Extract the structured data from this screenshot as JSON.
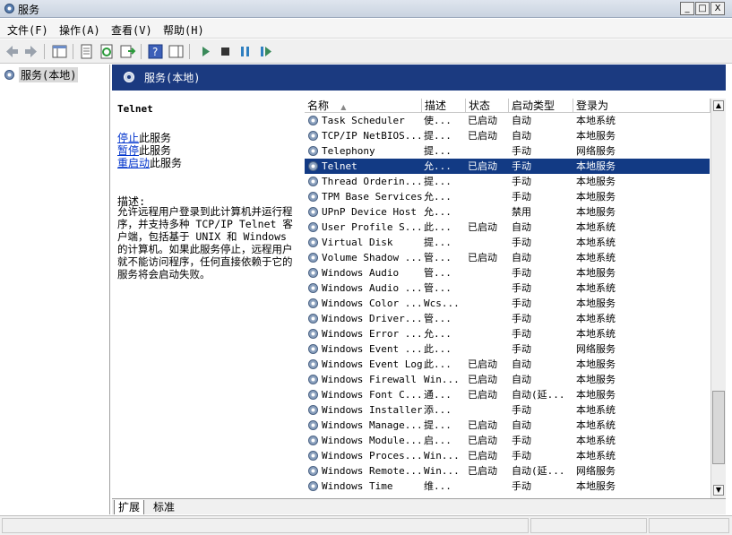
{
  "window": {
    "title": "服务",
    "btn_min": "_",
    "btn_max": "□",
    "btn_close": "X"
  },
  "menubar": [
    {
      "label": "文件(F)"
    },
    {
      "label": "操作(A)"
    },
    {
      "label": "查看(V)"
    },
    {
      "label": "帮助(H)"
    }
  ],
  "toolbar": {
    "icons": [
      "back-arrow-icon",
      "forward-arrow-icon",
      "show-tree-icon",
      "properties-icon",
      "refresh-icon",
      "export-list-icon",
      "help-icon",
      "action-pane-icon",
      "start-service-icon",
      "stop-service-icon",
      "pause-service-icon",
      "resume-service-icon"
    ]
  },
  "tree": {
    "root_label": "服务(本地)"
  },
  "header": {
    "title": "服务(本地)"
  },
  "description_pane": {
    "service_name": "Telnet",
    "stop_link": "停止",
    "stop_suffix": "此服务",
    "pause_link": "暂停",
    "pause_suffix": "此服务",
    "restart_link": "重启动",
    "restart_suffix": "此服务",
    "desc_label": "描述:",
    "desc_text": "允许远程用户登录到此计算机并运行程序，并支持多种 TCP/IP Telnet 客户端，包括基于 UNIX 和 Windows 的计算机。如果此服务停止，远程用户就不能访问程序，任何直接依赖于它的服务将会启动失败。"
  },
  "columns": {
    "name": "名称",
    "desc": "描述",
    "status": "状态",
    "startup": "启动类型",
    "logon": "登录为"
  },
  "rows": [
    {
      "name": "Task Scheduler",
      "desc": "使...",
      "status": "已启动",
      "startup": "自动",
      "logon": "本地系统"
    },
    {
      "name": "TCP/IP NetBIOS...",
      "desc": "提...",
      "status": "已启动",
      "startup": "自动",
      "logon": "本地服务"
    },
    {
      "name": "Telephony",
      "desc": "提...",
      "status": "",
      "startup": "手动",
      "logon": "网络服务"
    },
    {
      "name": "Telnet",
      "desc": "允...",
      "status": "已启动",
      "startup": "手动",
      "logon": "本地服务",
      "selected": true
    },
    {
      "name": "Thread Orderin...",
      "desc": "提...",
      "status": "",
      "startup": "手动",
      "logon": "本地服务"
    },
    {
      "name": "TPM Base Services",
      "desc": "允...",
      "status": "",
      "startup": "手动",
      "logon": "本地服务"
    },
    {
      "name": "UPnP Device Host",
      "desc": "允...",
      "status": "",
      "startup": "禁用",
      "logon": "本地服务"
    },
    {
      "name": "User Profile S...",
      "desc": "此...",
      "status": "已启动",
      "startup": "自动",
      "logon": "本地系统"
    },
    {
      "name": "Virtual Disk",
      "desc": "提...",
      "status": "",
      "startup": "手动",
      "logon": "本地系统"
    },
    {
      "name": "Volume Shadow ...",
      "desc": "管...",
      "status": "已启动",
      "startup": "自动",
      "logon": "本地系统"
    },
    {
      "name": "Windows Audio",
      "desc": "管...",
      "status": "",
      "startup": "手动",
      "logon": "本地服务"
    },
    {
      "name": "Windows Audio ...",
      "desc": "管...",
      "status": "",
      "startup": "手动",
      "logon": "本地系统"
    },
    {
      "name": "Windows Color ...",
      "desc": "Wcs...",
      "status": "",
      "startup": "手动",
      "logon": "本地服务"
    },
    {
      "name": "Windows Driver...",
      "desc": "管...",
      "status": "",
      "startup": "手动",
      "logon": "本地系统"
    },
    {
      "name": "Windows Error ...",
      "desc": "允...",
      "status": "",
      "startup": "手动",
      "logon": "本地系统"
    },
    {
      "name": "Windows Event ...",
      "desc": "此...",
      "status": "",
      "startup": "手动",
      "logon": "网络服务"
    },
    {
      "name": "Windows Event Log",
      "desc": "此...",
      "status": "已启动",
      "startup": "自动",
      "logon": "本地服务"
    },
    {
      "name": "Windows Firewall",
      "desc": "Win...",
      "status": "已启动",
      "startup": "自动",
      "logon": "本地服务"
    },
    {
      "name": "Windows Font C...",
      "desc": "通...",
      "status": "已启动",
      "startup": "自动(延...",
      "logon": "本地服务"
    },
    {
      "name": "Windows Installer",
      "desc": "添...",
      "status": "",
      "startup": "手动",
      "logon": "本地系统"
    },
    {
      "name": "Windows Manage...",
      "desc": "提...",
      "status": "已启动",
      "startup": "自动",
      "logon": "本地系统"
    },
    {
      "name": "Windows Module...",
      "desc": "启...",
      "status": "已启动",
      "startup": "手动",
      "logon": "本地系统"
    },
    {
      "name": "Windows Proces...",
      "desc": "Win...",
      "status": "已启动",
      "startup": "手动",
      "logon": "本地系统"
    },
    {
      "name": "Windows Remote...",
      "desc": "Win...",
      "status": "已启动",
      "startup": "自动(延...",
      "logon": "网络服务"
    },
    {
      "name": "Windows Time",
      "desc": "维...",
      "status": "",
      "startup": "手动",
      "logon": "本地服务"
    }
  ],
  "tabs": [
    {
      "label": "扩展"
    },
    {
      "label": "标准"
    }
  ],
  "colors": {
    "header_bg": "#1b3a80",
    "selection_bg": "#123a84",
    "link": "#0033cc"
  }
}
